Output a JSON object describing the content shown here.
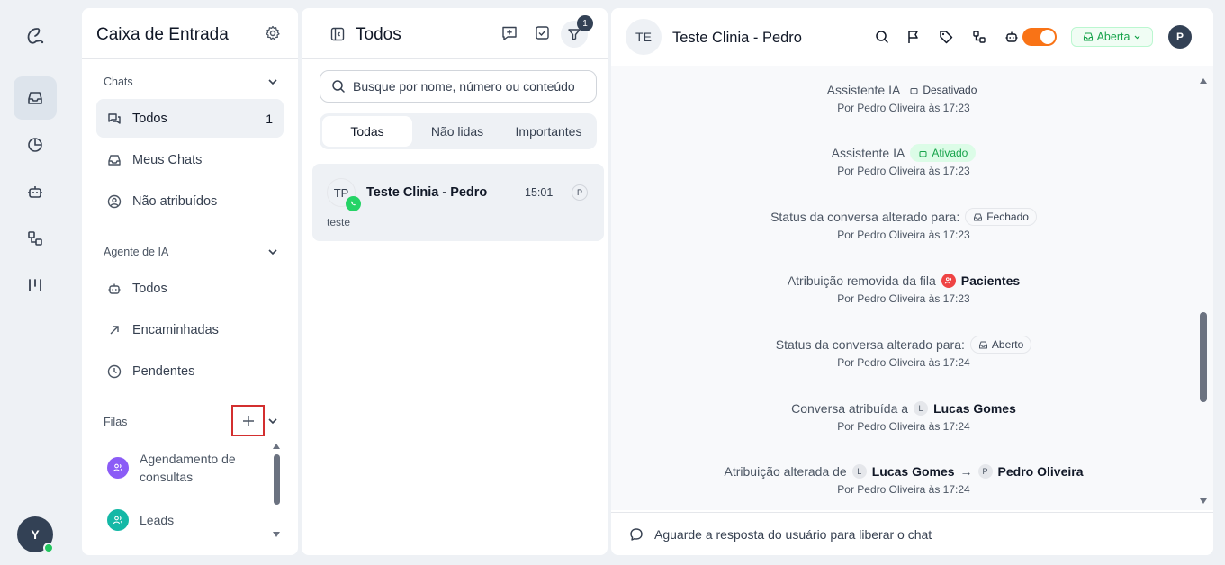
{
  "user": {
    "initial": "Y"
  },
  "inbox": {
    "title": "Caixa de Entrada",
    "chats_section": "Chats",
    "chats_items": [
      {
        "label": "Todos",
        "count": "1"
      },
      {
        "label": "Meus Chats"
      },
      {
        "label": "Não atribuídos"
      }
    ],
    "ai_section": "Agente de IA",
    "ai_items": [
      {
        "label": "Todos"
      },
      {
        "label": "Encaminhadas"
      },
      {
        "label": "Pendentes"
      }
    ],
    "queues_section": "Filas",
    "queues": [
      {
        "label": "Agendamento de consultas",
        "color": "#8b5cf6"
      },
      {
        "label": "Leads",
        "color": "#14b8a6"
      }
    ]
  },
  "list": {
    "title": "Todos",
    "filter_badge": "1",
    "search_placeholder": "Busque por nome, número ou conteúdo",
    "tabs": [
      "Todas",
      "Não lidas",
      "Importantes"
    ],
    "conversations": [
      {
        "initials": "TP",
        "name": "Teste Clinia - Pedro",
        "time": "15:01",
        "agent": "P",
        "preview": "teste"
      }
    ]
  },
  "chat": {
    "avatar": "TE",
    "title": "Teste Clinia - Pedro",
    "status": "Aberta",
    "user_initial": "P",
    "events": [
      {
        "text": "Assistente IA",
        "chip": "Desativado",
        "by": "Por Pedro Oliveira às 17:23"
      },
      {
        "text": "Assistente IA",
        "chip": "Ativado",
        "by": "Por Pedro Oliveira às 17:23"
      },
      {
        "text": "Status da conversa alterado para:",
        "chip": "Fechado",
        "by": "Por Pedro Oliveira às 17:23"
      },
      {
        "text": "Atribuição removida da fila",
        "chip": "Pacientes",
        "by": "Por Pedro Oliveira às 17:23"
      },
      {
        "text": "Status da conversa alterado para:",
        "chip": "Aberto",
        "by": "Por Pedro Oliveira às 17:24"
      },
      {
        "text": "Conversa atribuída a",
        "avatar": "L",
        "name": "Lucas Gomes",
        "by": "Por Pedro Oliveira às 17:24"
      },
      {
        "text": "Atribuição alterada de",
        "avatar": "L",
        "name": "Lucas Gomes",
        "arrow": "→",
        "avatar2": "P",
        "name2": "Pedro Oliveira",
        "by": "Por Pedro Oliveira às 17:24"
      }
    ],
    "footer": "Aguarde a resposta do usuário para liberar o chat"
  },
  "colors": {
    "accent": "#f97316",
    "status_green": "#16a34a",
    "avatar_dark": "#334155",
    "whatsapp": "#25d366"
  }
}
